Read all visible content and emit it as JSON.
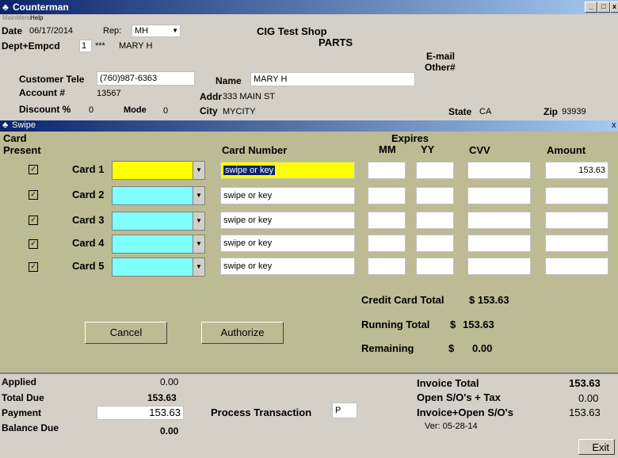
{
  "window": {
    "title": "Counterman",
    "min_glyph": "_",
    "max_glyph": "□",
    "close_glyph": "x"
  },
  "menu": {
    "item1": "MainMenu",
    "item2": "Help"
  },
  "header": {
    "date_label": "Date",
    "date_value": "06/17/2014",
    "rep_label": "Rep:",
    "rep_value": "MH",
    "shop_name": "CIG Test Shop",
    "shop_dept": "PARTS",
    "dept_label": "Dept+Empcd",
    "dept_value": "1",
    "dept_stars": "***",
    "dept_name": "MARY H",
    "email_label": "E-mail",
    "other_label": "Other#",
    "tele_label": "Customer Tele",
    "tele_value": "(760)987-6363",
    "name_label": "Name",
    "name_value": "MARY H",
    "account_label": "Account #",
    "account_value": "13567",
    "addr_label": "Addr",
    "addr_value": "333 MAIN ST",
    "discount_label": "Discount %",
    "discount_value": "0",
    "mode_label": "Mode",
    "mode_value": "0",
    "city_label": "City",
    "city_value": "MYCITY",
    "state_label": "State",
    "state_value": "CA",
    "zip_label": "Zip",
    "zip_value": "93939"
  },
  "swipe": {
    "title": "Swipe",
    "close_glyph": "x",
    "col_card": "Card",
    "col_present": "Present",
    "col_card_number": "Card Number",
    "col_expires": "Expires",
    "col_mm": "MM",
    "col_yy": "YY",
    "col_cvv": "CVV",
    "col_amount": "Amount",
    "cards": [
      {
        "label": "Card 1",
        "number": "swipe or key",
        "amount": "153.63"
      },
      {
        "label": "Card 2",
        "number": "swipe or key",
        "amount": ""
      },
      {
        "label": "Card 3",
        "number": "swipe or key",
        "amount": ""
      },
      {
        "label": "Card 4",
        "number": "swipe or key",
        "amount": ""
      },
      {
        "label": "Card 5",
        "number": "swipe or key",
        "amount": ""
      }
    ],
    "check_glyph": "✓",
    "dropdown_glyph": "▼",
    "credit_total_label": "Credit Card Total",
    "credit_total_value": "$ 153.63",
    "running_total_label": "Running Total",
    "running_total_dollar": "$",
    "running_total_value": "153.63",
    "remaining_label": "Remaining",
    "remaining_dollar": "$",
    "remaining_value": "0.00",
    "cancel_label": "Cancel",
    "authorize_label": "Authorize",
    "active_color": "#ffff00",
    "inactive_color": "#80ffff"
  },
  "footer": {
    "applied_label": "Applied",
    "applied_value": "0.00",
    "total_due_label": "Total Due",
    "total_due_value": "153.63",
    "payment_label": "Payment",
    "payment_value": "153.63",
    "balance_label": "Balance Due",
    "balance_value": "0.00",
    "process_label": "Process Transaction",
    "process_value": "P",
    "invoice_total_label": "Invoice Total",
    "invoice_total_value": "153.63",
    "open_so_label": "Open S/O's + Tax",
    "open_so_value": "0.00",
    "invoice_open_label": "Invoice+Open S/O's",
    "invoice_open_value": "153.63",
    "version": "Ver: 05-28-14",
    "exit_label": "Exit"
  }
}
